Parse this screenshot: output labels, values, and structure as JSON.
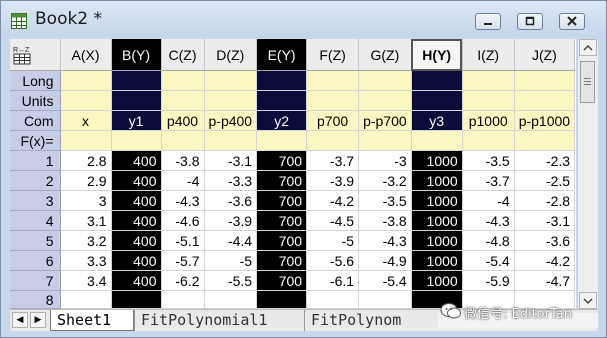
{
  "window": {
    "title": "Book2 *"
  },
  "columns": [
    "A(X)",
    "B(Y)",
    "C(Z)",
    "D(Z)",
    "E(Y)",
    "F(Z)",
    "G(Z)",
    "H(Y)",
    "I(Z)",
    "J(Z)"
  ],
  "selected_columns": [
    1,
    4,
    7
  ],
  "active_column": 7,
  "meta_rows": {
    "long": {
      "label": "Long",
      "values": [
        "",
        "",
        "",
        "",
        "",
        "",
        "",
        "",
        "",
        ""
      ]
    },
    "units": {
      "label": "Units",
      "values": [
        "",
        "",
        "",
        "",
        "",
        "",
        "",
        "",
        "",
        ""
      ]
    },
    "comments": {
      "label": "Com",
      "values": [
        "x",
        "y1",
        "p400",
        "p-p400",
        "y2",
        "p700",
        "p-p700",
        "y3",
        "p1000",
        "p-p1000"
      ]
    },
    "fx": {
      "label": "F(x)=",
      "values": [
        "",
        "",
        "",
        "",
        "",
        "",
        "",
        "",
        "",
        ""
      ]
    }
  },
  "data_rows": [
    {
      "n": "1",
      "values": [
        "2.8",
        "400",
        "-3.8",
        "-3.1",
        "700",
        "-3.7",
        "-3",
        "1000",
        "-3.5",
        "-2.3"
      ]
    },
    {
      "n": "2",
      "values": [
        "2.9",
        "400",
        "-4",
        "-3.3",
        "700",
        "-3.9",
        "-3.2",
        "1000",
        "-3.7",
        "-2.5"
      ]
    },
    {
      "n": "3",
      "values": [
        "3",
        "400",
        "-4.3",
        "-3.6",
        "700",
        "-4.2",
        "-3.5",
        "1000",
        "-4",
        "-2.8"
      ]
    },
    {
      "n": "4",
      "values": [
        "3.1",
        "400",
        "-4.6",
        "-3.9",
        "700",
        "-4.5",
        "-3.8",
        "1000",
        "-4.3",
        "-3.1"
      ]
    },
    {
      "n": "5",
      "values": [
        "3.2",
        "400",
        "-5.1",
        "-4.4",
        "700",
        "-5",
        "-4.3",
        "1000",
        "-4.8",
        "-3.6"
      ]
    },
    {
      "n": "6",
      "values": [
        "3.3",
        "400",
        "-5.7",
        "-5",
        "700",
        "-5.6",
        "-4.9",
        "1000",
        "-5.4",
        "-4.2"
      ]
    },
    {
      "n": "7",
      "values": [
        "3.4",
        "400",
        "-6.2",
        "-5.5",
        "700",
        "-6.1",
        "-5.4",
        "1000",
        "-5.9",
        "-4.7"
      ]
    },
    {
      "n": "8",
      "values": [
        "",
        "",
        "",
        "",
        "",
        "",
        "",
        "",
        "",
        ""
      ]
    }
  ],
  "sheet_tabs": [
    {
      "label": "Sheet1",
      "active": true
    },
    {
      "label": "FitPolynomial1",
      "active": false
    },
    {
      "label": "FitPolynom",
      "active": false
    }
  ],
  "watermark": {
    "text": "微信号: EditorTan"
  },
  "icons": {
    "app": "worksheet-icon",
    "corner": "sort-worksheet-icon",
    "minimize": "minimize-icon",
    "maximize": "maximize-icon",
    "close": "close-icon"
  },
  "colors": {
    "selected_column": "#000000",
    "selected_meta": "#0c0c38",
    "meta_background": "#fbf7c2",
    "row_header": "#c7cde6"
  }
}
